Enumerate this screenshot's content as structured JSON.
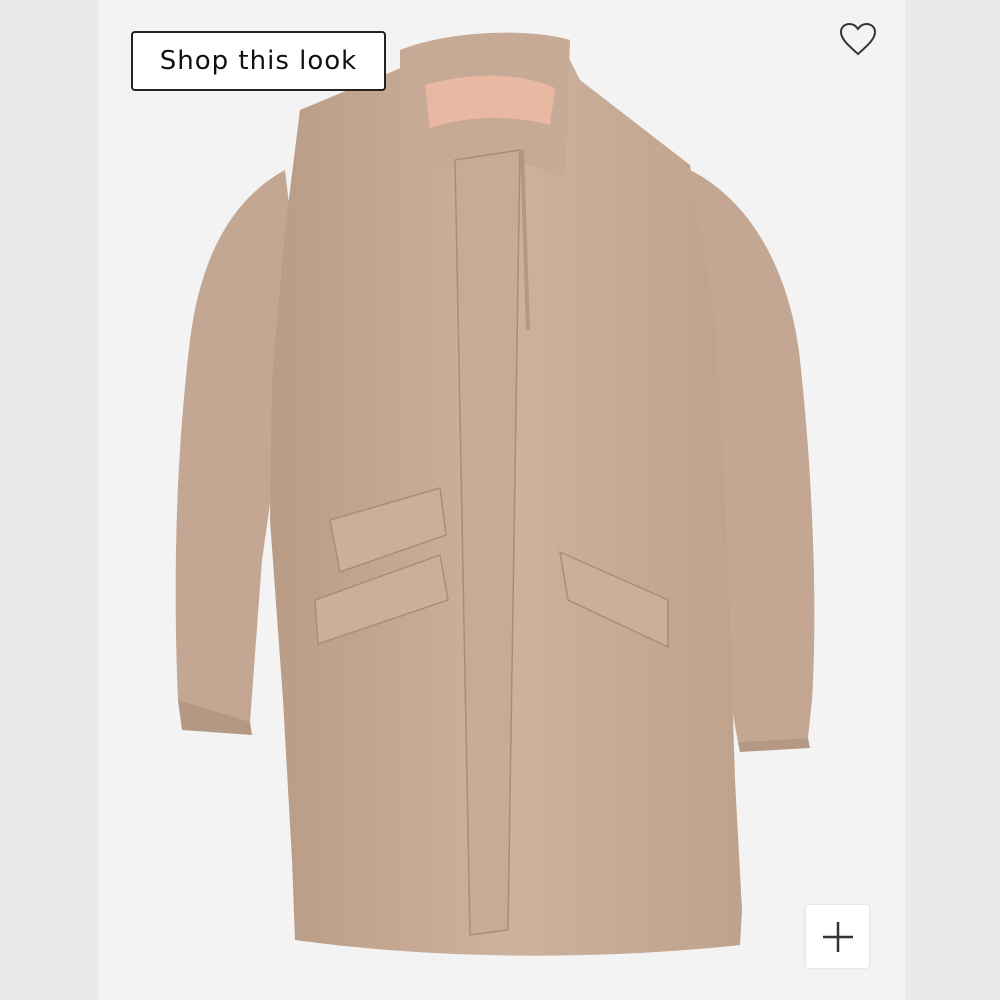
{
  "shop_button": {
    "label": "Shop this look"
  },
  "icons": {
    "favorite": "heart-icon",
    "add": "plus-icon"
  },
  "colors": {
    "coat": "#c9ad97",
    "lining": "#e9b8a2",
    "button_border": "#222222"
  }
}
